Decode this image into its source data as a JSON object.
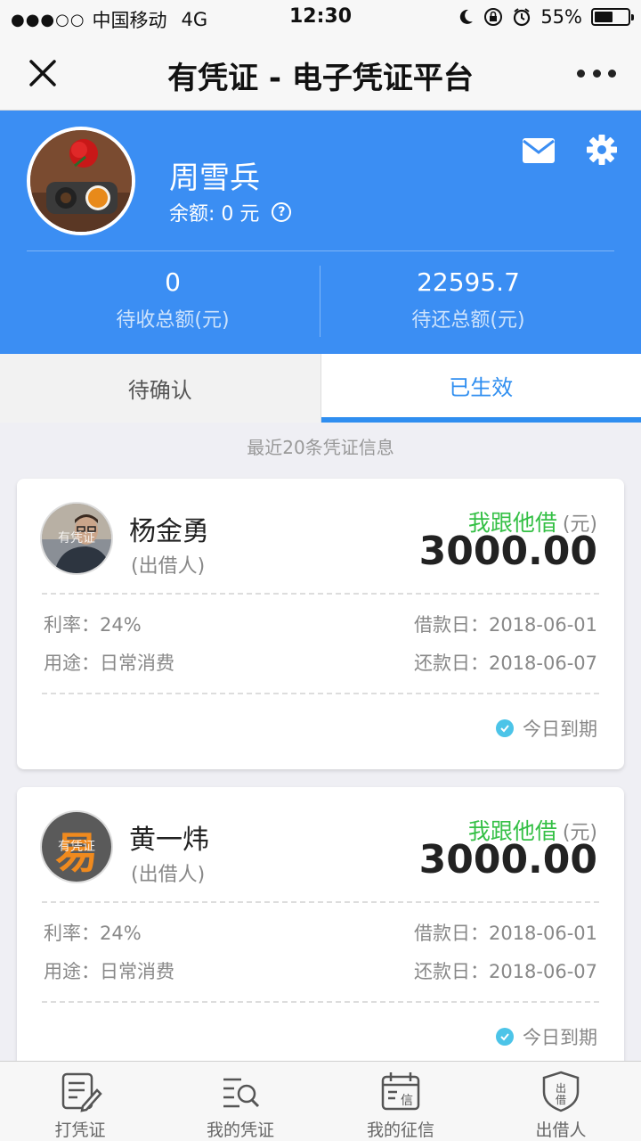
{
  "status_bar": {
    "carrier": "中国移动",
    "network": "4G",
    "time": "12:30",
    "battery": "55%",
    "battery_level": 0.55
  },
  "nav": {
    "title": "有凭证 - 电子凭证平台"
  },
  "profile": {
    "name": "周雪兵",
    "balance": "余额: 0 元"
  },
  "stats": [
    {
      "value": "0",
      "label": "待收总额(元)"
    },
    {
      "value": "22595.7",
      "label": "待还总额(元)"
    }
  ],
  "tabs": [
    {
      "label": "待确认",
      "active": false
    },
    {
      "label": "已生效",
      "active": true
    }
  ],
  "section_note": "最近20条凭证信息",
  "cards": [
    {
      "avatar_watermark": "有凭证",
      "name": "杨金勇",
      "role": "(出借人)",
      "type": "我跟他借",
      "unit": "(元)",
      "amount": "3000.00",
      "rate": "利率：24%",
      "purpose": "用途：日常消费",
      "loan_date": "借款日：2018-06-01",
      "repay_date": "还款日：2018-06-07",
      "due": "今日到期"
    },
    {
      "avatar_watermark": "有凭证",
      "name": "黄一炜",
      "role": "(出借人)",
      "type": "我跟他借",
      "unit": "(元)",
      "amount": "3000.00",
      "rate": "利率：24%",
      "purpose": "用途：日常消费",
      "loan_date": "借款日：2018-06-01",
      "repay_date": "还款日：2018-06-07",
      "due": "今日到期"
    }
  ],
  "bottom_nav": [
    {
      "label": "打凭证",
      "icon": "write-voucher-icon"
    },
    {
      "label": "我的凭证",
      "icon": "voucher-search-icon"
    },
    {
      "label": "我的征信",
      "icon": "credit-calendar-icon"
    },
    {
      "label": "出借人",
      "icon": "lender-shield-icon"
    }
  ],
  "colors": {
    "header_blue": "#3b8ef3",
    "tab_active": "#2f8ef0",
    "loan_green": "#35c046",
    "check_cyan": "#4cc4e8"
  }
}
